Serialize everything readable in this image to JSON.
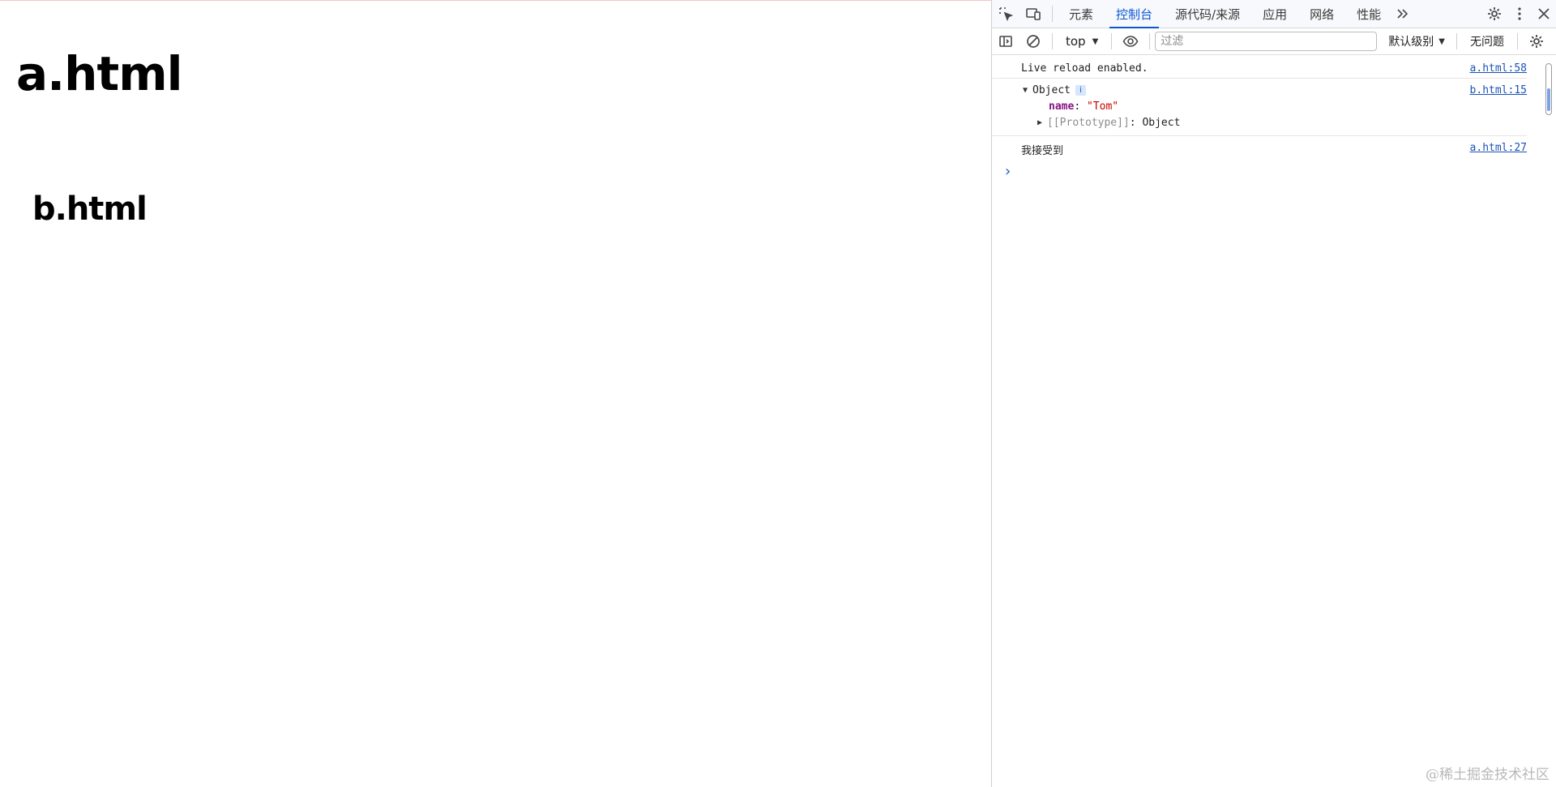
{
  "page": {
    "title": "a.html",
    "iframe_title": "b.html"
  },
  "devtools": {
    "tabs": [
      {
        "label": "元素"
      },
      {
        "label": "控制台"
      },
      {
        "label": "源代码/来源"
      },
      {
        "label": "应用"
      },
      {
        "label": "网络"
      },
      {
        "label": "性能"
      }
    ],
    "active_tab": "控制台",
    "toolbar": {
      "context": "top",
      "filter_placeholder": "过滤",
      "level": "默认级别",
      "issues": "无问题"
    },
    "console": {
      "messages": [
        {
          "text": "Live reload enabled.",
          "source": "a.html:58"
        },
        {
          "object_label": "Object",
          "info": "i",
          "prop_key": "name",
          "prop_value": "\"Tom\"",
          "proto_label": "[[Prototype]]",
          "proto_value": "Object",
          "source": "b.html:15"
        },
        {
          "text": "我接受到",
          "source": "a.html:27"
        }
      ],
      "prompt": "›"
    }
  },
  "watermark": "@稀土掘金技术社区"
}
